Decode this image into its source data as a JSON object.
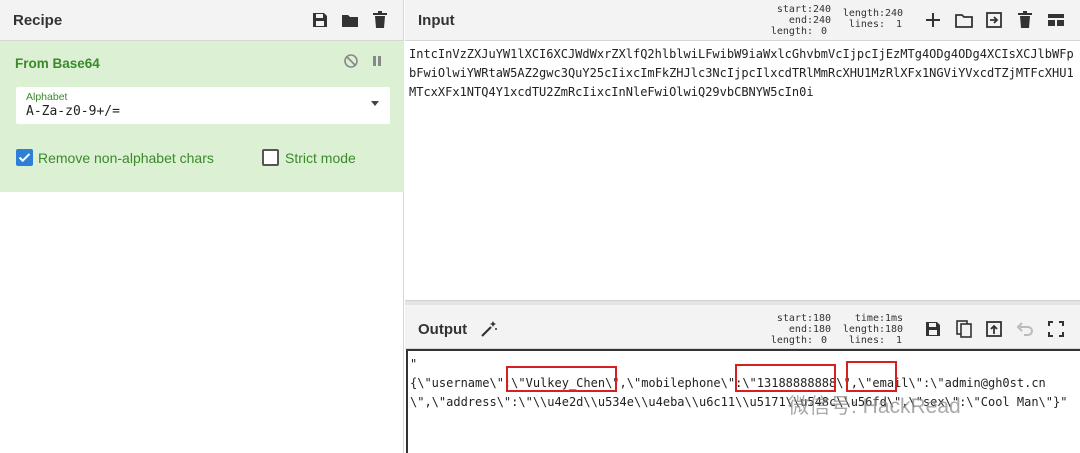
{
  "recipe": {
    "title": "Recipe",
    "operation": {
      "name": "From Base64",
      "alphabet_label": "Alphabet",
      "alphabet_value": "A-Za-z0-9+/=",
      "remove_label": "Remove non-alphabet chars",
      "remove_checked": true,
      "strict_label": "Strict mode",
      "strict_checked": false
    }
  },
  "input": {
    "title": "Input",
    "stats_keys1": "start:\nend:\nlength:",
    "stats_vals1": "240\n240\n0",
    "stats_keys2": "length:\nlines:",
    "stats_vals2": "240\n1",
    "text": "IntcInVzZXJuYW1lXCI6XCJWdWxrZXlfQ2hlblwiLFwibW9iaWxlcGhvbmVcIjpcIjEzMTg4ODg4ODg4XCIsXCJlbWFpbFwiOlwiYWRtaW5AZ2gwc3QuY25cIixcImFkZHJlc3NcIjpcIlxcdTRlMmRcXHU1MzRlXFx1NGViYVxcdTZjMTFcXHU1MTcxXFx1NTQ4Y1xcdTU2ZmRcIixcInNleFwiOlwiQ29vbCBNYW5cIn0i"
  },
  "output": {
    "title": "Output",
    "stats_keys1": "start:\nend:\nlength:",
    "stats_vals1": "180\n180\n0",
    "stats_keys2": "time:\nlength:\nlines:",
    "stats_vals2": "1ms\n180\n1",
    "line1": "\"",
    "line2": "{\\\"username\\\":\\\"Vulkey_Chen\\\",\\\"mobilephone\\\":\\\"13188888888\\\",\\\"email\\\":\\\"admin@gh0st.cn\\\",\\\"address\\\":\\\"\\\\u4e2d\\\\u534e\\\\u4eba\\\\u6c11\\\\u5171\\\\u548c\\\\u56fd\\\",\\\"sex\\\":\\\"Cool Man\\\"}\""
  },
  "watermark": "微信号: HackRead",
  "colors": {
    "operation_bg": "#dcf0d4",
    "operation_text": "#3a8a2a",
    "checkbox": "#2e7fd6",
    "highlight_box": "#d42020"
  },
  "icons": [
    "save-icon",
    "folder-icon",
    "trash-icon",
    "pause-icon",
    "disable-icon",
    "plus-icon",
    "import-icon",
    "layout-icon",
    "magic-wand-icon",
    "copy-icon",
    "replace-input-icon",
    "undo-icon",
    "maximise-icon"
  ]
}
